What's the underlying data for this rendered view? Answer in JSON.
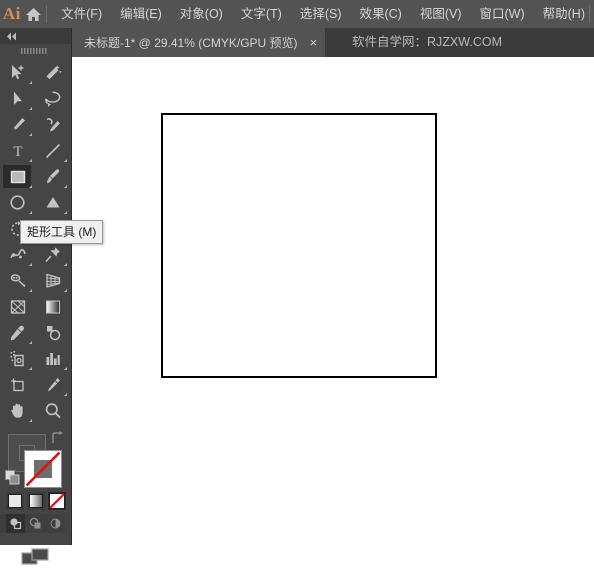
{
  "app": {
    "logo_text": "Ai",
    "home_icon": "home-icon"
  },
  "menubar": {
    "items": [
      {
        "label": "文件(F)",
        "name": "menu-file"
      },
      {
        "label": "编辑(E)",
        "name": "menu-edit"
      },
      {
        "label": "对象(O)",
        "name": "menu-object"
      },
      {
        "label": "文字(T)",
        "name": "menu-type"
      },
      {
        "label": "选择(S)",
        "name": "menu-select"
      },
      {
        "label": "效果(C)",
        "name": "menu-effect"
      },
      {
        "label": "视图(V)",
        "name": "menu-view"
      },
      {
        "label": "窗口(W)",
        "name": "menu-window"
      },
      {
        "label": "帮助(H)",
        "name": "menu-help"
      }
    ]
  },
  "tabbar": {
    "document_tab": {
      "label": "未标题-1* @ 29.41% (CMYK/GPU 预览)",
      "close_glyph": "×"
    },
    "watermark": "软件自学网：RJZXW.COM"
  },
  "toolbar": {
    "collapse_icon": "double-chevron-left-icon",
    "grip_icon": "drag-grip-icon",
    "tools": [
      {
        "name": "selection-tool",
        "icon": "arrow-plus-icon",
        "has_flyout": true,
        "selected": false
      },
      {
        "name": "magic-wand-tool",
        "icon": "magic-wand-icon",
        "has_flyout": false,
        "selected": false
      },
      {
        "name": "direct-selection-tool",
        "icon": "solid-arrow-icon",
        "has_flyout": true,
        "selected": false
      },
      {
        "name": "lasso-tool",
        "icon": "lasso-icon",
        "has_flyout": false,
        "selected": false
      },
      {
        "name": "pen-tool",
        "icon": "pen-icon",
        "has_flyout": true,
        "selected": false
      },
      {
        "name": "curvature-tool",
        "icon": "curvature-pen-icon",
        "has_flyout": false,
        "selected": false
      },
      {
        "name": "type-tool",
        "icon": "type-t-icon",
        "has_flyout": true,
        "selected": false
      },
      {
        "name": "line-segment-tool",
        "icon": "line-diagonal-icon",
        "has_flyout": true,
        "selected": false
      },
      {
        "name": "rectangle-tool",
        "icon": "rectangle-icon",
        "has_flyout": true,
        "selected": true
      },
      {
        "name": "paintbrush-tool",
        "icon": "paintbrush-icon",
        "has_flyout": true,
        "selected": false
      },
      {
        "name": "ellipse-tool",
        "icon": "ellipse-icon",
        "has_flyout": true,
        "selected": false
      },
      {
        "name": "shape-builder-tool",
        "icon": "shape-builder-icon",
        "has_flyout": true,
        "selected": false
      },
      {
        "name": "rotate-tool",
        "icon": "rotate-icon",
        "has_flyout": true,
        "selected": false
      },
      {
        "name": "free-transform-tool",
        "icon": "free-transform-icon",
        "has_flyout": true,
        "selected": false
      },
      {
        "name": "width-tool",
        "icon": "width-warp-icon",
        "has_flyout": true,
        "selected": false
      },
      {
        "name": "puppet-warp-tool",
        "icon": "pushpin-icon",
        "has_flyout": true,
        "selected": false
      },
      {
        "name": "blob-brush-tool",
        "icon": "blob-brush-icon",
        "has_flyout": true,
        "selected": false
      },
      {
        "name": "perspective-grid-tool",
        "icon": "perspective-grid-icon",
        "has_flyout": true,
        "selected": false
      },
      {
        "name": "mesh-tool",
        "icon": "mesh-icon",
        "has_flyout": false,
        "selected": false
      },
      {
        "name": "gradient-tool",
        "icon": "gradient-bar-icon",
        "has_flyout": false,
        "selected": false
      },
      {
        "name": "eyedropper-tool",
        "icon": "eyedropper-icon",
        "has_flyout": true,
        "selected": false
      },
      {
        "name": "blend-tool",
        "icon": "blend-circles-icon",
        "has_flyout": false,
        "selected": false
      },
      {
        "name": "symbol-sprayer-tool",
        "icon": "symbol-sprayer-icon",
        "has_flyout": true,
        "selected": false
      },
      {
        "name": "column-graph-tool",
        "icon": "bar-chart-icon",
        "has_flyout": true,
        "selected": false
      },
      {
        "name": "artboard-tool",
        "icon": "artboard-icon",
        "has_flyout": false,
        "selected": false
      },
      {
        "name": "slice-tool",
        "icon": "slice-knife-icon",
        "has_flyout": true,
        "selected": false
      },
      {
        "name": "hand-tool",
        "icon": "hand-icon",
        "has_flyout": true,
        "selected": false
      },
      {
        "name": "zoom-tool",
        "icon": "magnifier-icon",
        "has_flyout": false,
        "selected": false
      }
    ],
    "tooltip": {
      "text": "矩形工具 (M)",
      "visible": true
    },
    "color_controls": {
      "fill_label": "fill-swatch",
      "stroke_label": "stroke-swatch",
      "fill_state": "none",
      "stroke_state": "none",
      "swap_icon": "swap-fill-stroke-icon",
      "default_icon": "default-fill-stroke-icon",
      "modes": [
        {
          "name": "color-mode-button",
          "icon": "solid-color-icon",
          "active": false
        },
        {
          "name": "gradient-mode-button",
          "icon": "gradient-icon",
          "active": false
        },
        {
          "name": "none-mode-button",
          "icon": "none-slash-icon",
          "active": true
        }
      ],
      "draw_modes": [
        {
          "name": "draw-normal-button",
          "icon": "draw-normal-icon",
          "active": true
        },
        {
          "name": "draw-behind-button",
          "icon": "draw-behind-icon",
          "active": false
        },
        {
          "name": "draw-inside-button",
          "icon": "draw-inside-icon",
          "active": false
        }
      ],
      "screen_mode": {
        "name": "change-screen-mode-button",
        "icon": "screen-mode-icon"
      }
    }
  },
  "canvas": {
    "background_color": "#ffffff",
    "artboard": {
      "name": "artboard-rectangle",
      "fill_color": "#ffffff",
      "stroke_color": "#000000"
    }
  },
  "colors": {
    "menubar_bg": "#535353",
    "tabbar_bg": "#3b3b3b",
    "toolbar_bg": "#454545",
    "accent": "#d48c5a",
    "text": "#d6d6d6",
    "none_red": "#e01010"
  }
}
